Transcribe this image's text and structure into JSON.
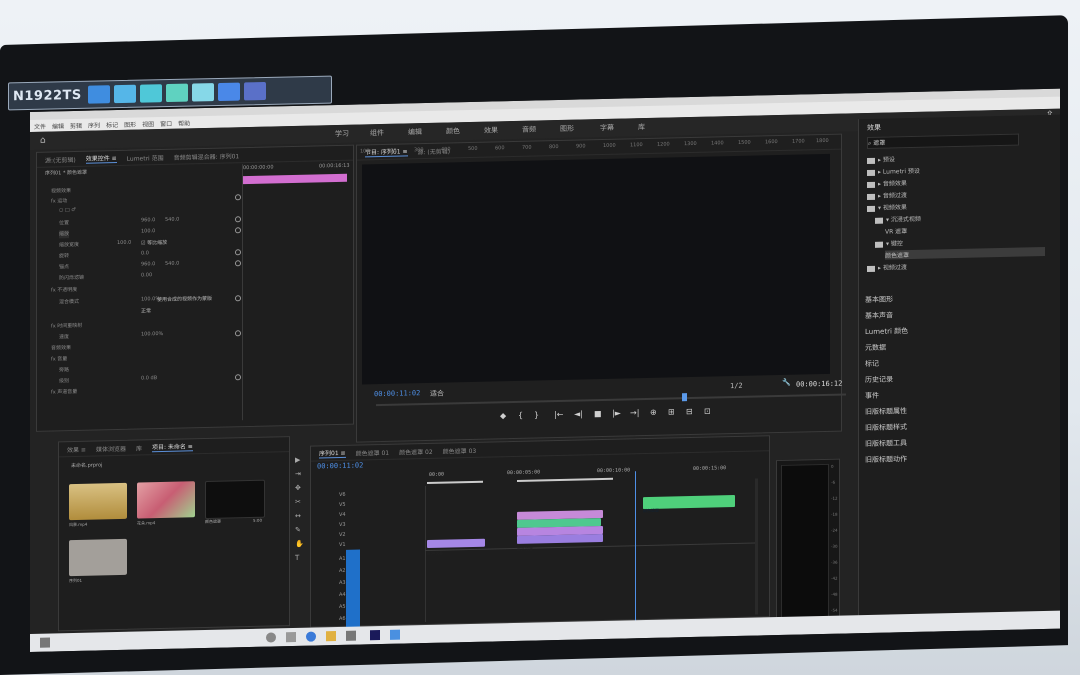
{
  "monitor": {
    "model_label": "N1922TS"
  },
  "app": {
    "menu": [
      "文件",
      "编辑",
      "剪辑",
      "序列",
      "标记",
      "图形",
      "视图",
      "窗口",
      "帮助"
    ],
    "workspaces": [
      "学习",
      "组件",
      "编辑",
      "颜色",
      "效果",
      "音频",
      "图形",
      "字幕",
      "库"
    ]
  },
  "effect_controls": {
    "tabs": [
      "源:(无剪辑)",
      "效果控件 ≡",
      "Lumetri 范围",
      "音频剪辑混合器: 序列01"
    ],
    "subheader": [
      "序列01 * 颜色遮罩"
    ],
    "rows": [
      "视频效果",
      "fx 运动",
      "○ □ ♂",
      "位置",
      "缩放",
      "缩放宽度",
      "☑ 等比缩放",
      "旋转",
      "锚点",
      "防闪烁滤镜",
      "fx 不透明度",
      "混合模式",
      "fx 时间重映射",
      "速度",
      "音频效果",
      "fx 音量",
      "旁路",
      "级别",
      "fx 声道音量"
    ],
    "values": [
      "960.0",
      "540.0",
      "100.0",
      "100.0",
      "0.0",
      "960.0",
      "540.0",
      "0.00",
      "100.0%",
      "正常",
      "100.00%",
      "0.0 dB"
    ],
    "checkbox_label_1": "等比缩放",
    "checkbox_label_2": "使用合成的视频作为蒙版",
    "time_display": "00:00:00:00",
    "timecode_end": "00:00:16:13"
  },
  "program": {
    "tabs": [
      "节目: 序列01 ≡",
      "源: (无剪辑)"
    ],
    "ruler": [
      "100",
      "200",
      "300",
      "400",
      "500",
      "600",
      "700",
      "800",
      "900",
      "1000",
      "1100",
      "1200",
      "1300",
      "1400",
      "1500",
      "1600",
      "1700",
      "1800"
    ],
    "timecode_current": "00:00:11:02",
    "fit": "适合",
    "resolution": "1/2",
    "timecode_duration": "00:00:16:12",
    "transport": [
      "◆",
      "{",
      "}",
      "|←",
      "◄|",
      "■",
      "|►",
      "→|",
      "⊕",
      "⊞",
      "⊟",
      "⊡"
    ]
  },
  "project": {
    "tabs": [
      "项目: 未命名",
      "效果 ≡",
      "媒体浏览器",
      "库",
      "信息"
    ],
    "active_tab": "项目: 未命名 ≡",
    "path": "未命名.prproj",
    "items": [
      {
        "name": "风景.mp4",
        "duration": "4:25",
        "color": "#c9a64a"
      },
      {
        "name": "花朵.mp4",
        "duration": "4:25",
        "color": "#c85e73"
      },
      {
        "name": "颜色遮罩",
        "duration": "5:00",
        "color": "#0e0e0e"
      },
      {
        "name": "序列01",
        "duration": "16:13",
        "color": "#9a9590"
      }
    ]
  },
  "timeline": {
    "tabs": [
      "序列01 ≡",
      "颜色遮罩 01",
      "颜色遮罩 02",
      "颜色遮罩 03"
    ],
    "timecode": "00:00:11:02",
    "ruler": [
      "00:00",
      "00:00:05:00",
      "00:00:10:00",
      "00:00:15:00"
    ],
    "tracks": [
      "V6",
      "V5",
      "V4",
      "V3",
      "V2",
      "V1",
      "A1",
      "A2",
      "A3",
      "A4",
      "A5",
      "A6"
    ],
    "clips": [
      {
        "label": "颜色遮罩",
        "color": "#4fd07b"
      },
      {
        "label": "颜色遮罩",
        "color": "#c68ad8"
      },
      {
        "label": "颜色遮罩",
        "color": "#4fc88f"
      },
      {
        "label": "颜色遮罩",
        "color": "#b785e0"
      },
      {
        "label": "颜色遮罩",
        "color": "#9a7ee0"
      },
      {
        "label": "颜色遮罩",
        "color": "#a587e6"
      }
    ]
  },
  "audio_meter": {
    "scale": [
      "0",
      "-6",
      "-12",
      "-18",
      "-24",
      "-30",
      "-36",
      "-42",
      "-48",
      "-54"
    ],
    "bottom": [
      "S",
      "S"
    ]
  },
  "libraries": {
    "title": "效果",
    "search_label": "遮罩",
    "tree": [
      "▸ 预设",
      "▸ Lumetri 预设",
      "▸ 音频效果",
      "▸ 音频过渡",
      "▾ 视频效果",
      "▾ 沉浸式视频",
      "VR 遮罩",
      "▾ 键控",
      "颜色遮罩",
      "▸ 视频过渡"
    ],
    "panels": [
      "基本图形",
      "基本声音",
      "Lumetri 颜色",
      "元数据",
      "标记",
      "历史记录",
      "事件",
      "旧版标题属性",
      "旧版标题样式",
      "旧版标题工具",
      "旧版标题动作"
    ]
  },
  "colors": {
    "accent_blue": "#2f7fe0",
    "pink_clip": "#d26ed0",
    "green_clip": "#4fd07b"
  }
}
